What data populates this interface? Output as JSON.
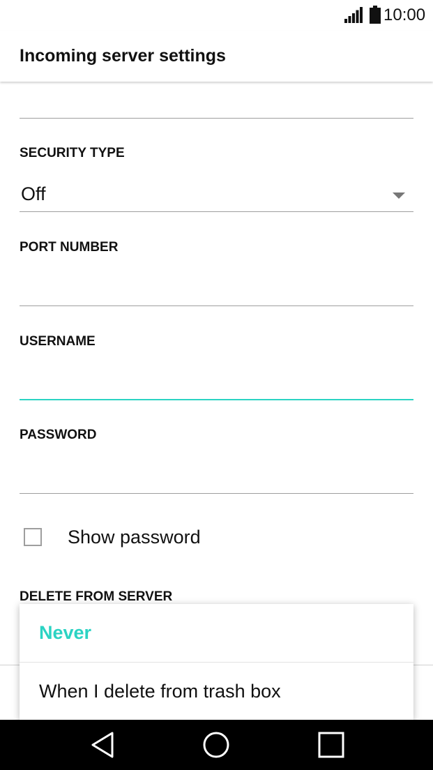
{
  "status_bar": {
    "time": "10:00",
    "icons": [
      "signal-icon",
      "battery-icon"
    ]
  },
  "app_bar": {
    "title": "Incoming server settings"
  },
  "form": {
    "security_type": {
      "label": "SECURITY TYPE",
      "value": "Off"
    },
    "port_number": {
      "label": "PORT NUMBER",
      "value": ""
    },
    "username": {
      "label": "USERNAME",
      "value": ""
    },
    "password": {
      "label": "PASSWORD",
      "value": ""
    },
    "show_password": {
      "label": "Show password",
      "checked": false
    },
    "delete_from_server": {
      "label": "DELETE FROM SERVER"
    }
  },
  "dropdown": {
    "options": [
      {
        "label": "Never",
        "selected": true
      },
      {
        "label": "When I delete from trash box",
        "selected": false
      }
    ]
  },
  "nav_bar": {
    "icons": [
      "back-icon",
      "home-icon",
      "recents-icon"
    ]
  },
  "colors": {
    "accent": "#2bd3c3",
    "nav_background": "#000000",
    "divider": "#9e9e9e"
  }
}
